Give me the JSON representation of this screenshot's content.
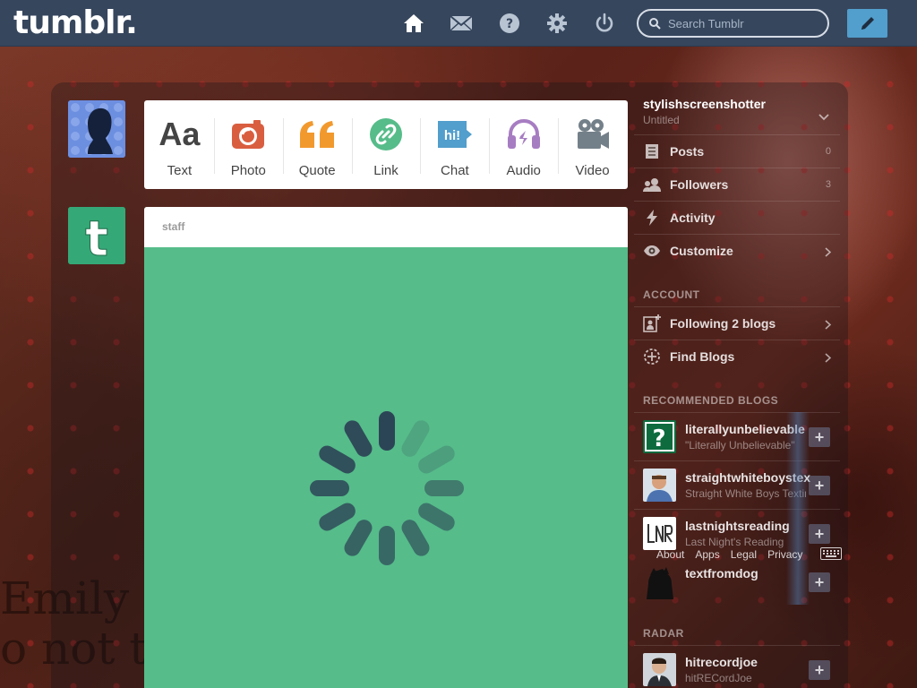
{
  "header": {
    "logo": "tumblr.",
    "search_placeholder": "Search Tumblr"
  },
  "background": {
    "line1": "Emily F",
    "line2": "o not the pe"
  },
  "post_types": [
    {
      "label": "Text",
      "glyph": "Aa",
      "color": "#444444"
    },
    {
      "label": "Photo",
      "color": "#d95e40"
    },
    {
      "label": "Quote",
      "color": "#f2992e"
    },
    {
      "label": "Link",
      "color": "#56bc8a"
    },
    {
      "label": "Chat",
      "glyph": "hi!",
      "color": "#529ecc"
    },
    {
      "label": "Audio",
      "color": "#a77dc2"
    },
    {
      "label": "Video",
      "color": "#748089"
    }
  ],
  "feed": {
    "author": "staff",
    "card_color": "#56bc8a"
  },
  "sidebar": {
    "blog_name": "stylishscreenshotter",
    "blog_title": "Untitled",
    "items": [
      {
        "label": "Posts",
        "count": "0"
      },
      {
        "label": "Followers",
        "count": "3"
      },
      {
        "label": "Activity"
      },
      {
        "label": "Customize"
      }
    ],
    "account_heading": "ACCOUNT",
    "account_items": [
      {
        "label": "Following 2 blogs"
      },
      {
        "label": "Find Blogs"
      }
    ],
    "recommended_heading": "RECOMMENDED BLOGS",
    "recommended": [
      {
        "name": "literallyunbelievable",
        "desc": "\"Literally Unbelievable\""
      },
      {
        "name": "straightwhiteboystexting",
        "desc": "Straight White Boys Texting"
      },
      {
        "name": "lastnightsreading",
        "desc": "Last Night's Reading"
      },
      {
        "name": "textfromdog",
        "desc": ""
      }
    ],
    "radar_heading": "RADAR",
    "radar": {
      "name": "hitrecordjoe",
      "desc": "hitRECordJoe"
    }
  },
  "footer": {
    "links": [
      "About",
      "Apps",
      "Legal",
      "Privacy"
    ]
  }
}
